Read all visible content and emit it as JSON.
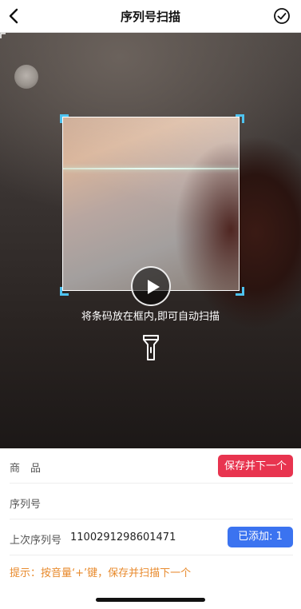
{
  "header": {
    "title": "序列号扫描",
    "back_icon": "chevron-left-icon",
    "confirm_icon": "check-circle-icon"
  },
  "scanner": {
    "hint": "将条码放在框内,即可自动扫描",
    "frame_corner_color": "#4ec3f0",
    "play_icon": "play-icon",
    "flashlight_icon": "flashlight-icon"
  },
  "form": {
    "product_label": "商　品",
    "save_next_button": "保存并下一个",
    "serial_label": "序列号",
    "serial_value": "",
    "last_serial_label": "上次序列号",
    "last_serial_value": "1100291298601471",
    "added_badge": "已添加: 1",
    "tip": "提示：按音量‘+’键，保存并扫描下一个"
  },
  "colors": {
    "save_button": "#e8344f",
    "added_badge": "#3b73f0",
    "tip_text": "#e88a2c"
  }
}
